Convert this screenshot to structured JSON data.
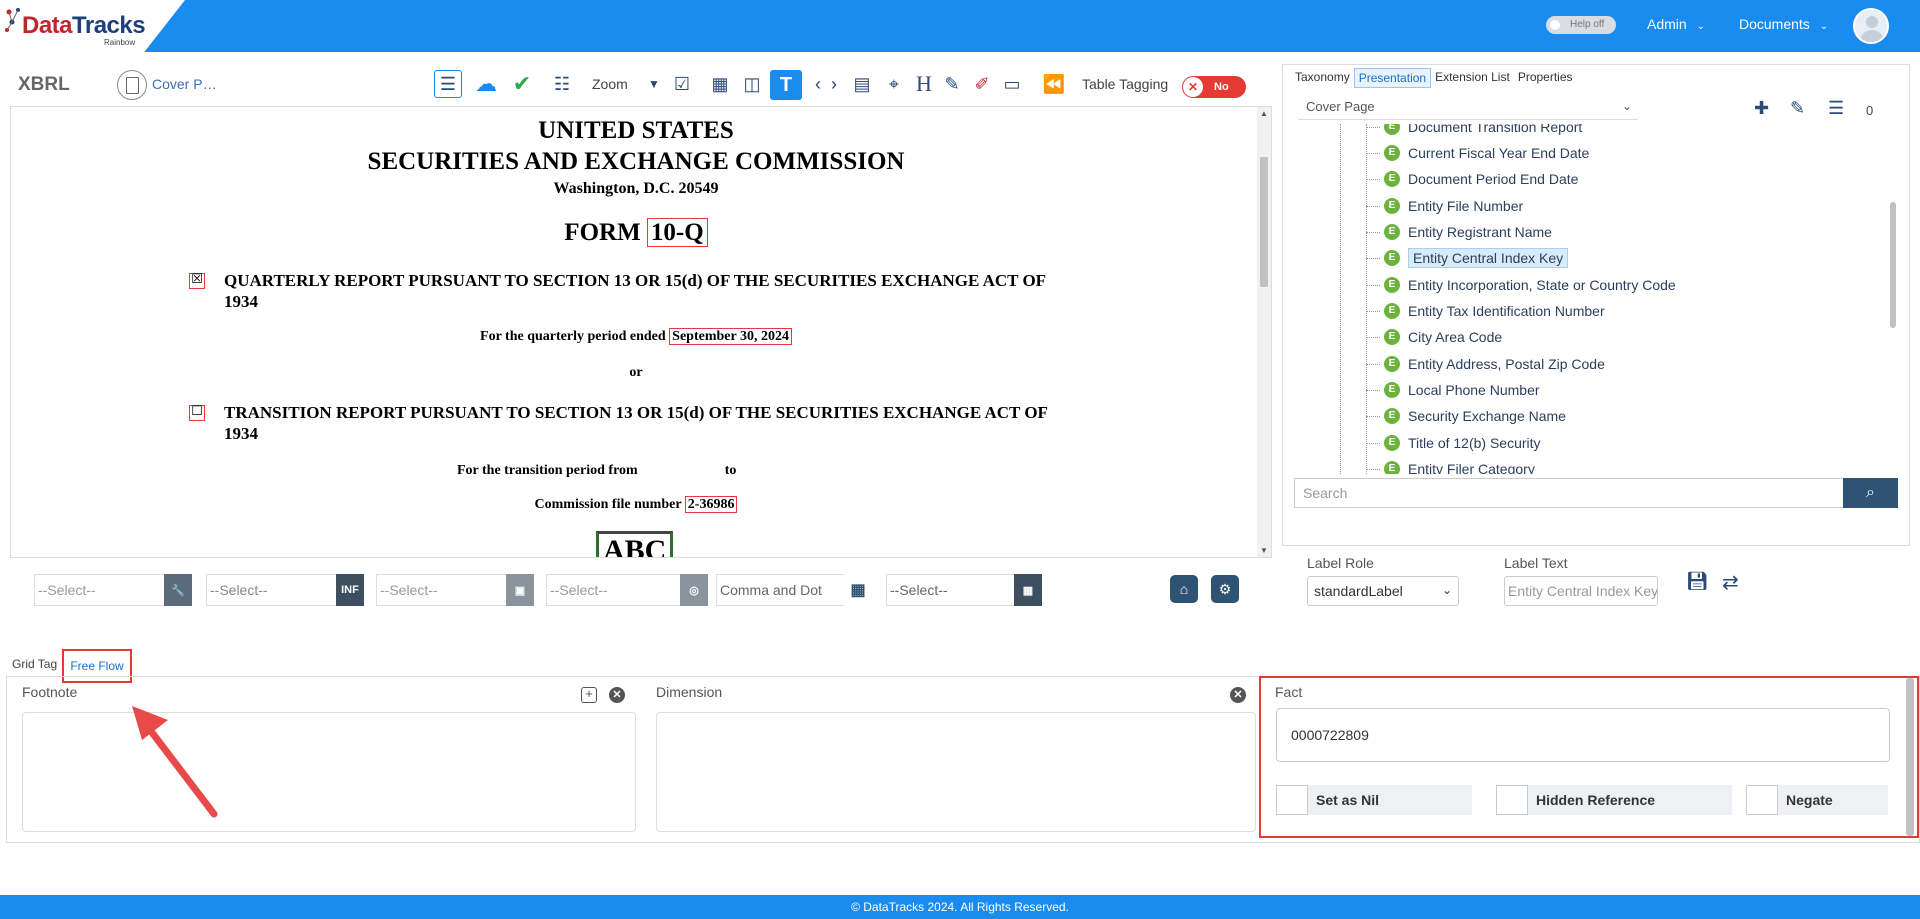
{
  "header": {
    "logo": "DataTracks",
    "logo_sub": "Rainbow",
    "help_toggle": "Help off",
    "admin": "Admin",
    "documents": "Documents"
  },
  "toolbar": {
    "xbrl": "XBRL",
    "cover": "Cover P…",
    "zoom": "Zoom",
    "table_tagging": "Table Tagging",
    "table_tagging_state": "No"
  },
  "document": {
    "line1": "UNITED STATES",
    "line2": "SECURITIES AND EXCHANGE COMMISSION",
    "line3": "Washington, D.C. 20549",
    "form_prefix": "FORM",
    "form_type": "10-Q",
    "quarterly_report": "QUARTERLY REPORT PURSUANT TO SECTION 13 OR 15(d) OF THE SECURITIES EXCHANGE ACT OF",
    "quarterly_year": "1934",
    "quarterly_period_label": "For the quarterly period ended",
    "quarterly_period_value": "September 30, 2024",
    "or": "or",
    "transition_report": "TRANSITION REPORT PURSUANT TO SECTION 13 OR 15(d) OF THE SECURITIES EXCHANGE ACT OF",
    "transition_year": "1934",
    "transition_from": "For the transition period from",
    "transition_to": "to",
    "commission_label": "Commission file number",
    "commission_value": "2-36986",
    "abc": "ABC",
    "quarterly_checked": "☒",
    "transition_checked": "☐"
  },
  "right_panel": {
    "tabs": [
      "Taxonomy",
      "Presentation",
      "Extension List",
      "Properties"
    ],
    "active_tab": "Presentation",
    "select": "Cover Page",
    "count": "0",
    "tree_items": [
      "Document Transition Report",
      "Current Fiscal Year End Date",
      "Document Period End Date",
      "Entity File Number",
      "Entity Registrant Name",
      "Entity Central Index Key",
      "Entity Incorporation, State or Country Code",
      "Entity Tax Identification Number",
      "City Area Code",
      "Entity Address, Postal Zip Code",
      "Local Phone Number",
      "Security Exchange Name",
      "Title of 12(b) Security",
      "Entity Filer Category"
    ],
    "selected_item": "Entity Central Index Key",
    "search_placeholder": "Search"
  },
  "selectors": {
    "sel1": "--Select--",
    "sel2": "--Select--",
    "sel2_btn": "INF",
    "sel3": "--Select--",
    "sel4": "--Select--",
    "sel5": "Comma and Dot",
    "sel6": "--Select--"
  },
  "label_panel": {
    "label_role_title": "Label Role",
    "label_role_value": "standardLabel",
    "label_text_title": "Label Text",
    "label_text_value": "Entity Central Index Key"
  },
  "bottom": {
    "tab_grid": "Grid Tag",
    "tab_free_flow": "Free Flow",
    "footnote_title": "Footnote",
    "dimension_title": "Dimension",
    "fact_title": "Fact",
    "fact_value": "0000722809",
    "set_as_nil": "Set as Nil",
    "hidden_reference": "Hidden Reference",
    "negate": "Negate"
  },
  "footer": {
    "text": "© DataTracks 2024. All Rights Reserved."
  },
  "colors": {
    "primary": "#1a8cf0",
    "highlight_red": "#e53935",
    "element_green": "#6cb33e",
    "dark_button": "#2f5373"
  }
}
